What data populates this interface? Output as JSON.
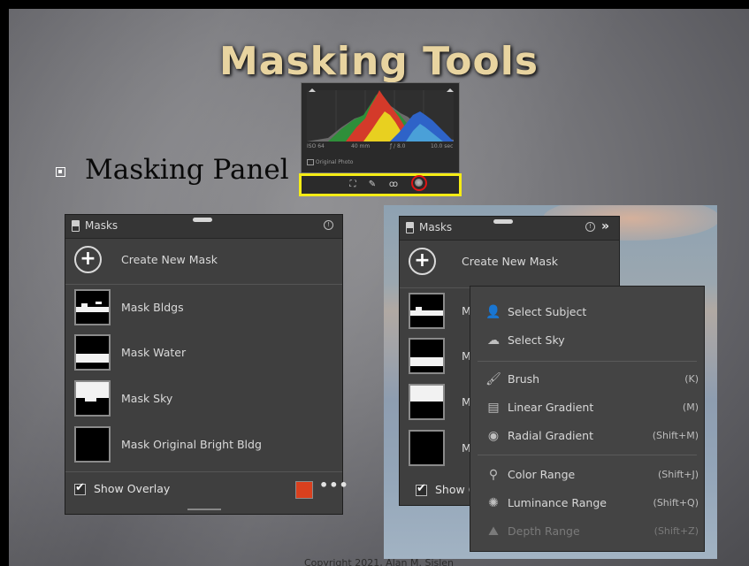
{
  "slide": {
    "title": "Masking Tools",
    "bullet": "Masking Panel",
    "copyright": "Copyright 2021, Alan M. Sislen"
  },
  "histogram": {
    "iso": "ISO 64",
    "focal": "40 mm",
    "aperture": "ƒ / 8.0",
    "shutter": "10.0 sec",
    "original_photo": "Original Photo",
    "highlight_color": "#f5ec15",
    "selected_tool_ring_color": "#e01414",
    "tools": [
      "crop-icon",
      "healing-icon",
      "red-eye-icon",
      "masking-icon"
    ]
  },
  "left_panel": {
    "title": "Masks",
    "create_label": "Create New Mask",
    "masks": [
      {
        "label": "Mask Bldgs"
      },
      {
        "label": "Mask Water"
      },
      {
        "label": "Mask Sky"
      },
      {
        "label": "Mask Original Bright Bldg"
      }
    ],
    "show_overlay_label": "Show Overlay",
    "show_overlay_checked": true,
    "overlay_color": "#d9401e"
  },
  "right_panel": {
    "title": "Masks",
    "create_label": "Create New Mask",
    "mask_prefix": "Ma",
    "show_overlay_label": "Show O"
  },
  "mask_menu": {
    "items": [
      {
        "label": "Select Subject",
        "shortcut": "",
        "icon": "person-icon"
      },
      {
        "label": "Select Sky",
        "shortcut": "",
        "icon": "sky-icon"
      },
      {
        "label": "Brush",
        "shortcut": "(K)",
        "icon": "brush-icon"
      },
      {
        "label": "Linear Gradient",
        "shortcut": "(M)",
        "icon": "linear-gradient-icon"
      },
      {
        "label": "Radial Gradient",
        "shortcut": "(Shift+M)",
        "icon": "radial-gradient-icon"
      },
      {
        "label": "Color Range",
        "shortcut": "(Shift+J)",
        "icon": "color-range-icon"
      },
      {
        "label": "Luminance Range",
        "shortcut": "(Shift+Q)",
        "icon": "luminance-range-icon"
      },
      {
        "label": "Depth Range",
        "shortcut": "(Shift+Z)",
        "icon": "depth-range-icon",
        "disabled": true
      }
    ]
  }
}
